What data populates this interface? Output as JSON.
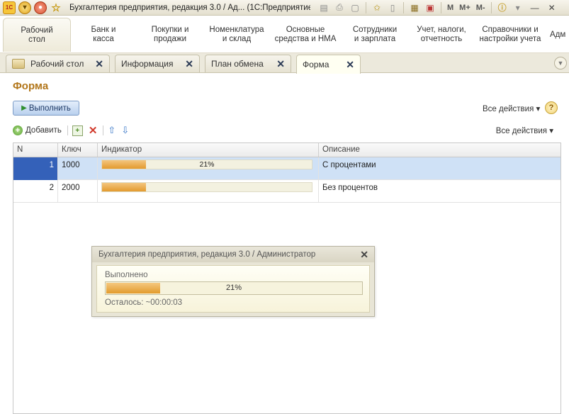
{
  "window": {
    "title": "Бухгалтерия предприятия, редакция 3.0 / Ад...  (1С:Предприятие)",
    "toolbar_text": [
      "M",
      "M+",
      "M-"
    ],
    "icons": [
      "app-logo-icon",
      "main-menu-icon",
      "history-icon",
      "favorites-star-icon",
      "save-icon",
      "print-icon",
      "preview-icon",
      "add-favorite-icon",
      "doc-icon",
      "calculator-icon",
      "calendar-icon",
      "info-icon",
      "minimize-icon",
      "close-icon"
    ]
  },
  "sections": [
    {
      "label": "Рабочий\nстол",
      "active": true
    },
    {
      "label": "Банк и\nкасса"
    },
    {
      "label": "Покупки и\nпродажи"
    },
    {
      "label": "Номенклатура\nи склад"
    },
    {
      "label": "Основные\nсредства и НМА"
    },
    {
      "label": "Сотрудники\nи зарплата"
    },
    {
      "label": "Учет, налоги,\nотчетность"
    },
    {
      "label": "Справочники и\nнастройки учета"
    },
    {
      "label": "Адм"
    }
  ],
  "tabs": [
    {
      "label": "Рабочий стол"
    },
    {
      "label": "Информация"
    },
    {
      "label": "План обмена"
    },
    {
      "label": "Форма",
      "active": true
    }
  ],
  "form": {
    "title": "Форма",
    "run_button": "Выполнить",
    "all_actions": "Все действия",
    "help": "?",
    "table_commands": {
      "add": "Добавить",
      "all_actions": "Все действия"
    },
    "columns": [
      "N",
      "Ключ",
      "Индикатор",
      "Описание"
    ],
    "rows": [
      {
        "n": "1",
        "key": "1000",
        "progress": 21,
        "progress_text": "21%",
        "description": "С процентами",
        "selected": true
      },
      {
        "n": "2",
        "key": "2000",
        "progress": 21,
        "progress_text": "",
        "description": "Без процентов",
        "selected": false
      }
    ]
  },
  "dialog": {
    "title": "Бухгалтерия предприятия, редакция 3.0 / Администратор",
    "status": "Выполнено",
    "progress": 21,
    "progress_text": "21%",
    "remaining": "Осталось: ~00:00:03"
  },
  "colors": {
    "accent_title": "#b2761a",
    "progress_fill": "#e39a2e",
    "selection": "#cfe1f6",
    "selected_cell": "#3461b9"
  }
}
